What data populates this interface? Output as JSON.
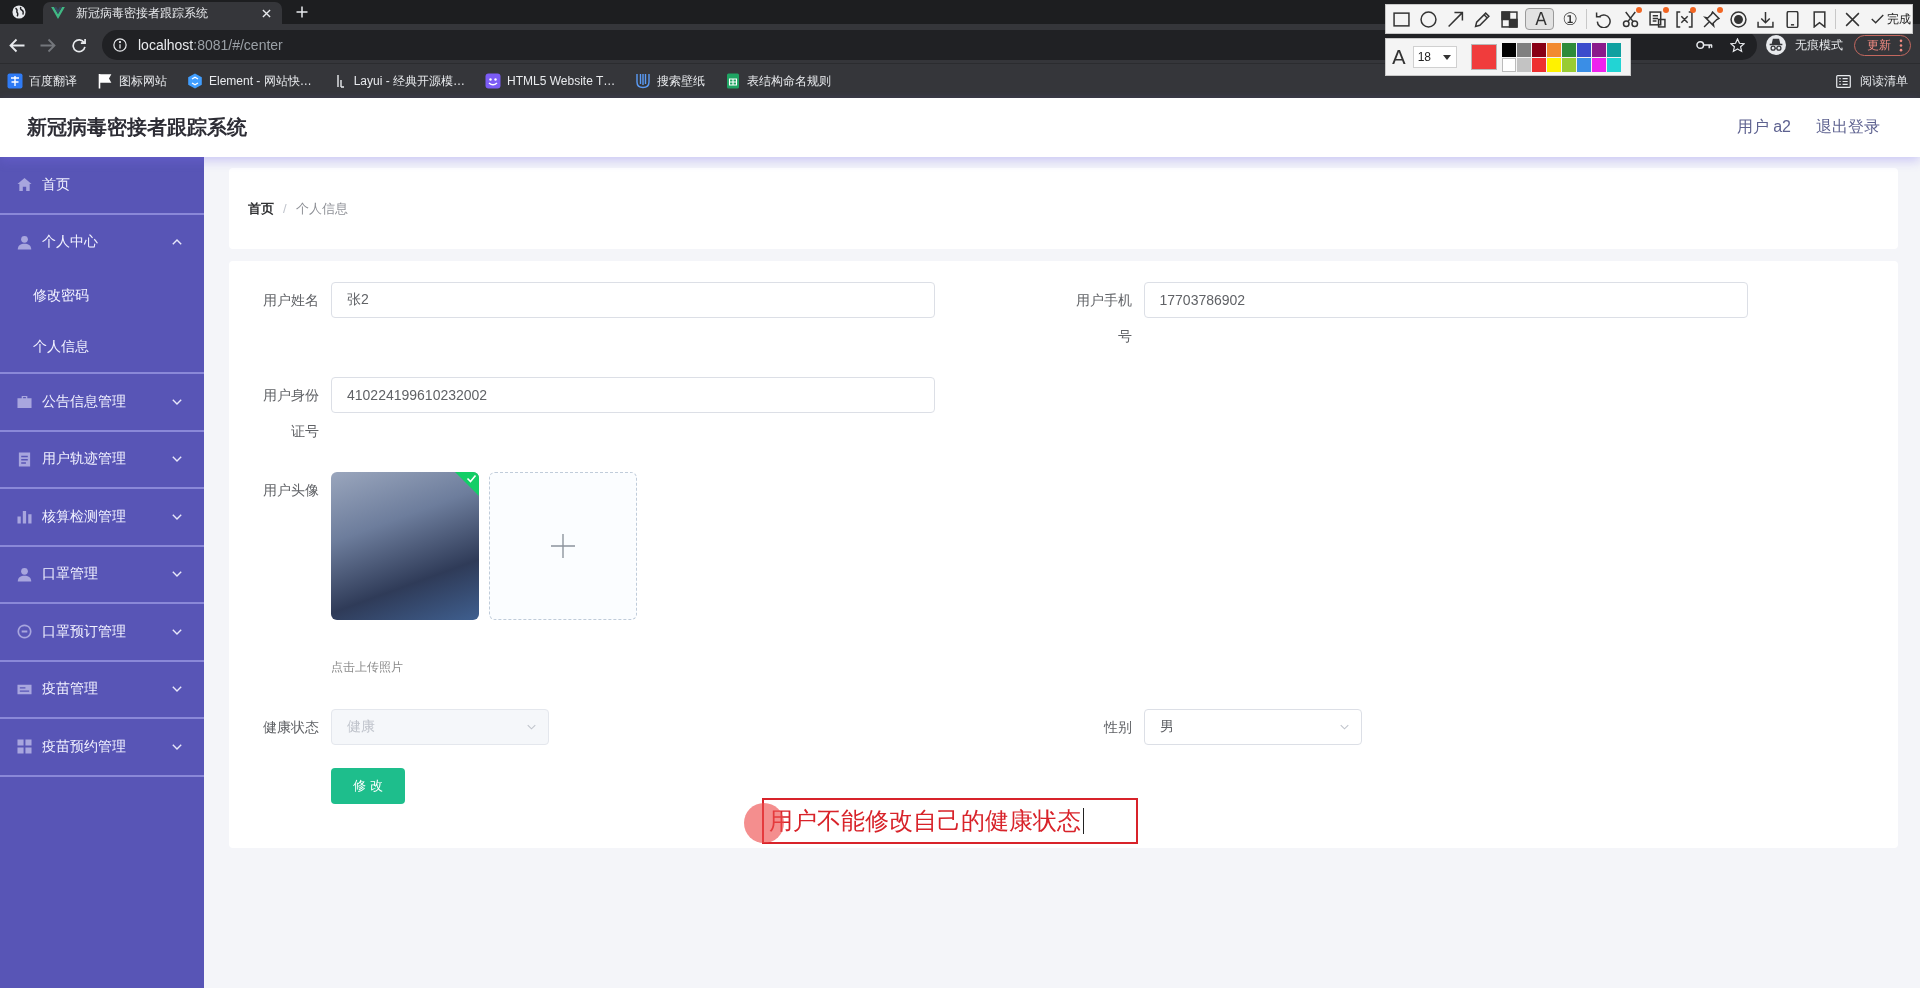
{
  "browser": {
    "tabs": [
      {
        "title": "新冠病毒密接者跟踪系统",
        "selected": true
      }
    ],
    "forward_disabled": true,
    "url": {
      "host": "localhost",
      "rest": ":8081/#/center"
    },
    "profile_label": "无痕模式",
    "update_label": "更新",
    "bookmarks": [
      "百度翻译",
      "图标网站",
      "Element - 网站快…",
      "Layui - 经典开源模…",
      "HTML5 Website T…",
      "搜索壁纸",
      "表结构命名规则"
    ],
    "reading_list": "阅读清单"
  },
  "snip_toolbar": {
    "tool_groups": [
      [
        {
          "selected": false,
          "new_dot": false
        },
        {
          "selected": false,
          "new_dot": false
        },
        {
          "selected": false,
          "new_dot": false
        },
        {
          "selected": false,
          "new_dot": false
        },
        {
          "selected": false,
          "new_dot": false
        },
        {
          "glyph": "A",
          "selected": true,
          "new_dot": false
        },
        {
          "glyph": "①",
          "selected": false,
          "new_dot": false
        }
      ],
      [
        {
          "selected": false,
          "new_dot": false
        },
        {
          "selected": false,
          "new_dot": true
        },
        {
          "selected": false,
          "new_dot": true
        },
        {
          "selected": false,
          "new_dot": true
        },
        {
          "selected": false,
          "new_dot": true
        },
        {
          "selected": false,
          "new_dot": false
        },
        {
          "selected": false,
          "new_dot": false
        },
        {
          "selected": false,
          "new_dot": false
        },
        {
          "selected": false,
          "new_dot": false
        }
      ],
      [
        {
          "selected": false,
          "new_dot": false
        }
      ]
    ],
    "done_label": "完成",
    "font_glyph": "A",
    "font_size": "18",
    "current_swatch": {
      "color": "#f03c3c"
    },
    "palette": [
      {
        "color": "#000000"
      },
      {
        "color": "#808080"
      },
      {
        "color": "#880015"
      },
      {
        "color": "#f28a30"
      },
      {
        "color": "#2e8b3a"
      },
      {
        "color": "#3c4ccc"
      },
      {
        "color": "#8b1a8b"
      },
      {
        "color": "#10a0a0"
      },
      {
        "color": "#ffffff"
      },
      {
        "color": "#c3c3c3"
      },
      {
        "color": "#ee3030"
      },
      {
        "color": "#fff200"
      },
      {
        "color": "#99cc33"
      },
      {
        "color": "#3a8ee6"
      },
      {
        "color": "#ee22ee"
      },
      {
        "color": "#22d4d4"
      }
    ]
  },
  "header": {
    "title": "新冠病毒密接者跟踪系统",
    "user": "用户 a2",
    "logout": "退出登录"
  },
  "sidebar": {
    "items": [
      {
        "label": "首页"
      },
      {
        "label": "个人中心",
        "expanded": true,
        "children": [
          {
            "label": "修改密码"
          },
          {
            "label": "个人信息"
          }
        ]
      },
      {
        "label": "公告信息管理",
        "expanded": false
      },
      {
        "label": "用户轨迹管理",
        "expanded": false
      },
      {
        "label": "核算检测管理",
        "expanded": false
      },
      {
        "label": "口罩管理",
        "expanded": false
      },
      {
        "label": "口罩预订管理",
        "expanded": false
      },
      {
        "label": "疫苗管理",
        "expanded": false
      },
      {
        "label": "疫苗预约管理",
        "expanded": false
      }
    ]
  },
  "breadcrumb": {
    "items": [
      "首页",
      "个人信息"
    ],
    "separator": "/"
  },
  "form": {
    "fields": [
      {
        "kind": "input",
        "label": "用户姓名",
        "value": "张2"
      },
      {
        "kind": "input",
        "label": "用户手机号",
        "value": "17703786902"
      },
      {
        "kind": "input",
        "label": "用户身份证号",
        "value": "410224199610232002"
      },
      {
        "kind": "upload",
        "label": "用户头像",
        "uploaded": true,
        "hint": "点击上传照片"
      },
      {
        "kind": "select",
        "label": "健康状态",
        "value": "健康",
        "disabled": true
      },
      {
        "kind": "select",
        "label": "性别",
        "value": "男",
        "disabled": false
      }
    ],
    "submit": "修 改"
  },
  "annotation": {
    "text": "用户不能修改自己的健康状态"
  }
}
